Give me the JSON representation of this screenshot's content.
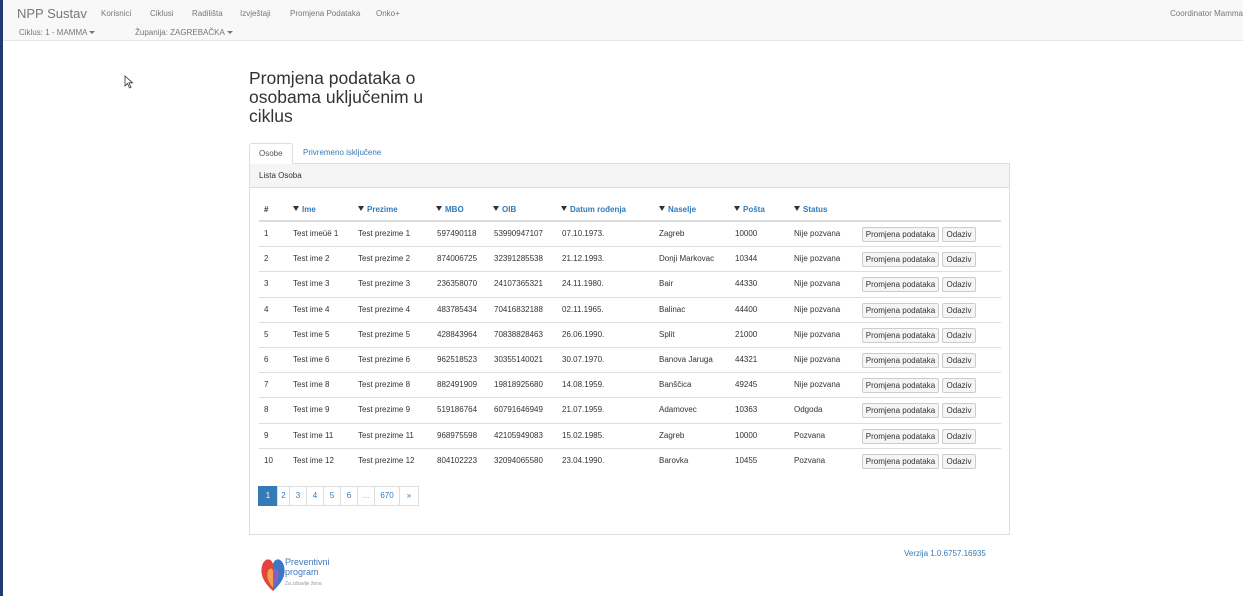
{
  "navbar": {
    "brand": "NPP Sustav",
    "links": [
      "Korisnici",
      "Ciklusi",
      "Radilišta",
      "Izvještaji",
      "Promjena Podataka",
      "Onko+"
    ],
    "cycle": "Ciklus: 1 - MAMMA",
    "county": "Županija: ZAGREBAČKA",
    "user": "Coordinator Mamma"
  },
  "page": {
    "title": "Promjena podataka o osobama uključenim u ciklus",
    "tabs": [
      "Osobe",
      "Privremeno isključene"
    ],
    "panel_title": "Lista Osoba"
  },
  "table": {
    "columns": [
      "#",
      "Ime",
      "Prezime",
      "MBO",
      "OIB",
      "Datum rođenja",
      "Naselje",
      "Pošta",
      "Status"
    ],
    "action_labels": [
      "Promjena podataka",
      "Odaziv"
    ],
    "rows": [
      [
        "1",
        "Test imeüë 1",
        "Test prezime 1",
        "597490118",
        "53990947107",
        "07.10.1973.",
        "Zagreb",
        "10000",
        "Nije pozvana"
      ],
      [
        "2",
        "Test ime 2",
        "Test prezime 2",
        "874006725",
        "32391285538",
        "21.12.1993.",
        "Donji Markovac",
        "10344",
        "Nije pozvana"
      ],
      [
        "3",
        "Test ime 3",
        "Test prezime 3",
        "236358070",
        "24107365321",
        "24.11.1980.",
        "Bair",
        "44330",
        "Nije pozvana"
      ],
      [
        "4",
        "Test ime 4",
        "Test prezime 4",
        "483785434",
        "70416832188",
        "02.11.1965.",
        "Balinac",
        "44400",
        "Nije pozvana"
      ],
      [
        "5",
        "Test ime 5",
        "Test prezime 5",
        "428843964",
        "70838828463",
        "26.06.1990.",
        "Split",
        "21000",
        "Nije pozvana"
      ],
      [
        "6",
        "Test ime 6",
        "Test prezime 6",
        "962518523",
        "30355140021",
        "30.07.1970.",
        "Banova Jaruga",
        "44321",
        "Nije pozvana"
      ],
      [
        "7",
        "Test ime 8",
        "Test prezime 8",
        "882491909",
        "19818925680",
        "14.08.1959.",
        "Banščica",
        "49245",
        "Nije pozvana"
      ],
      [
        "8",
        "Test ime 9",
        "Test prezime 9",
        "519186764",
        "60791646949",
        "21.07.1959.",
        "Adamovec",
        "10363",
        "Odgoda"
      ],
      [
        "9",
        "Test ime 11",
        "Test prezime 11",
        "968975598",
        "42105949083",
        "15.02.1985.",
        "Zagreb",
        "10000",
        "Pozvana"
      ],
      [
        "10",
        "Test ime 12",
        "Test prezime 12",
        "804102223",
        "32094065580",
        "23.04.1990.",
        "Barovka",
        "10455",
        "Pozvana"
      ]
    ]
  },
  "pagination": [
    "1",
    "2",
    "3",
    "4",
    "5",
    "6",
    "...",
    "670",
    "»"
  ],
  "footer": {
    "logo_line1": "Preventivni",
    "logo_line2": "program",
    "logo_sub": "Za zdravlje žena",
    "version": "Verzija 1.0.6757.16935"
  },
  "colors": {
    "link": "#337ab7",
    "active_page": "#337ab7",
    "logo_blue": "#3b78c4",
    "logo_red": "#e0443c",
    "logo_orange": "#f5a04a"
  }
}
